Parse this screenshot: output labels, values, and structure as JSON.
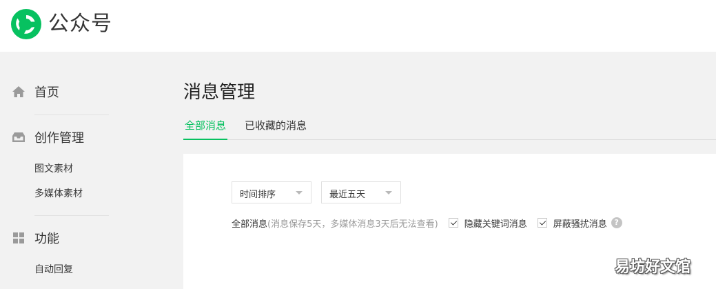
{
  "header": {
    "brand_name": "公众号"
  },
  "sidebar": {
    "home": {
      "label": "首页",
      "icon": "home-icon"
    },
    "create": {
      "label": "创作管理",
      "icon": "inbox-tray-icon",
      "items": [
        "图文素材",
        "多媒体素材"
      ]
    },
    "features": {
      "label": "功能",
      "icon": "grid-icon",
      "items": [
        "自动回复"
      ]
    }
  },
  "main": {
    "title": "消息管理",
    "tabs": [
      {
        "label": "全部消息",
        "active": true
      },
      {
        "label": "已收藏的消息",
        "active": false
      }
    ],
    "filters": {
      "sort": "时间排序",
      "range": "最近五天"
    },
    "info": {
      "lead": "全部消息",
      "hint": "(消息保存5天，多媒体消息3天后无法查看)"
    },
    "checkboxes": [
      {
        "label": "隐藏关键词消息",
        "checked": true
      },
      {
        "label": "屏蔽骚扰消息",
        "checked": true
      }
    ],
    "help_glyph": "?"
  },
  "watermark": "易坊好文馆",
  "colors": {
    "accent": "#07c160",
    "page_bg": "#f2f2f2",
    "text": "#353535"
  }
}
